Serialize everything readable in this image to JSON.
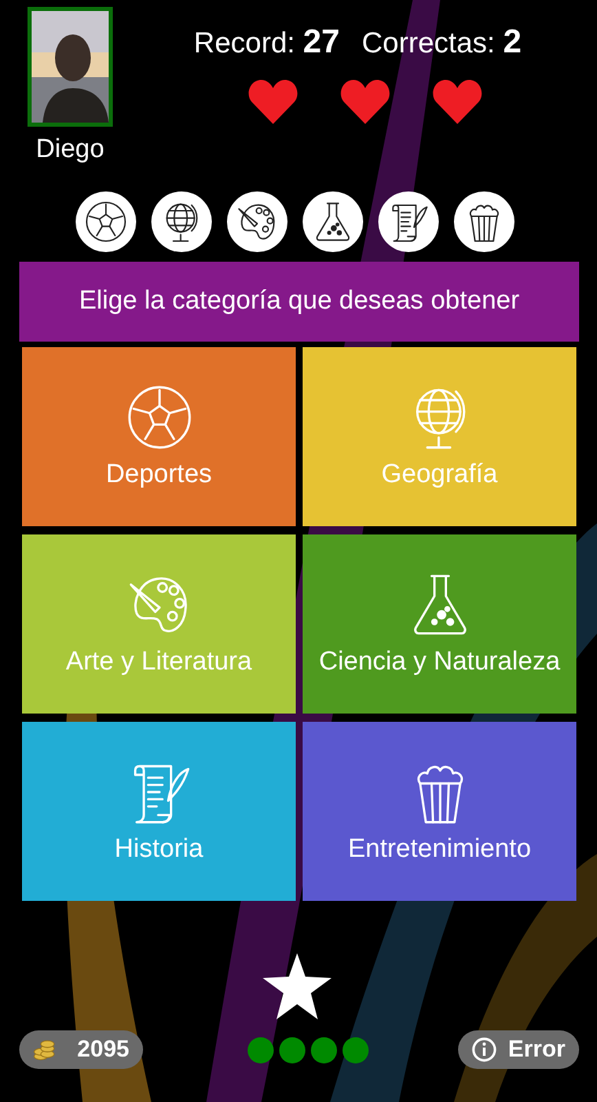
{
  "player": {
    "name": "Diego"
  },
  "stats": {
    "record_label": "Record:",
    "record_value": "27",
    "correct_label": "Correctas:",
    "correct_value": "2"
  },
  "lives": [
    {
      "filled": true
    },
    {
      "filled": true
    },
    {
      "filled": true
    }
  ],
  "category_badges": [
    {
      "kind": "ball"
    },
    {
      "kind": "globe"
    },
    {
      "kind": "palette"
    },
    {
      "kind": "flask"
    },
    {
      "kind": "scroll"
    },
    {
      "kind": "popcorn"
    }
  ],
  "prompt": "Elige la categoría que deseas obtener",
  "categories": [
    {
      "label": "Deportes",
      "kind": "ball",
      "color": "#e07129"
    },
    {
      "label": "Geografía",
      "kind": "globe",
      "color": "#e6c233"
    },
    {
      "label": "Arte y Literatura",
      "kind": "palette",
      "color": "#a9c83a"
    },
    {
      "label": "Ciencia y Naturaleza",
      "kind": "flask",
      "color": "#4f9a1f"
    },
    {
      "label": "Historia",
      "kind": "scroll",
      "color": "#22add5"
    },
    {
      "label": "Entretenimiento",
      "kind": "popcorn",
      "color": "#5b58cf"
    }
  ],
  "coins": "2095",
  "progress_dots": [
    {
      "filled": true
    },
    {
      "filled": true
    },
    {
      "filled": true
    },
    {
      "filled": true
    }
  ],
  "error_button": "Error"
}
